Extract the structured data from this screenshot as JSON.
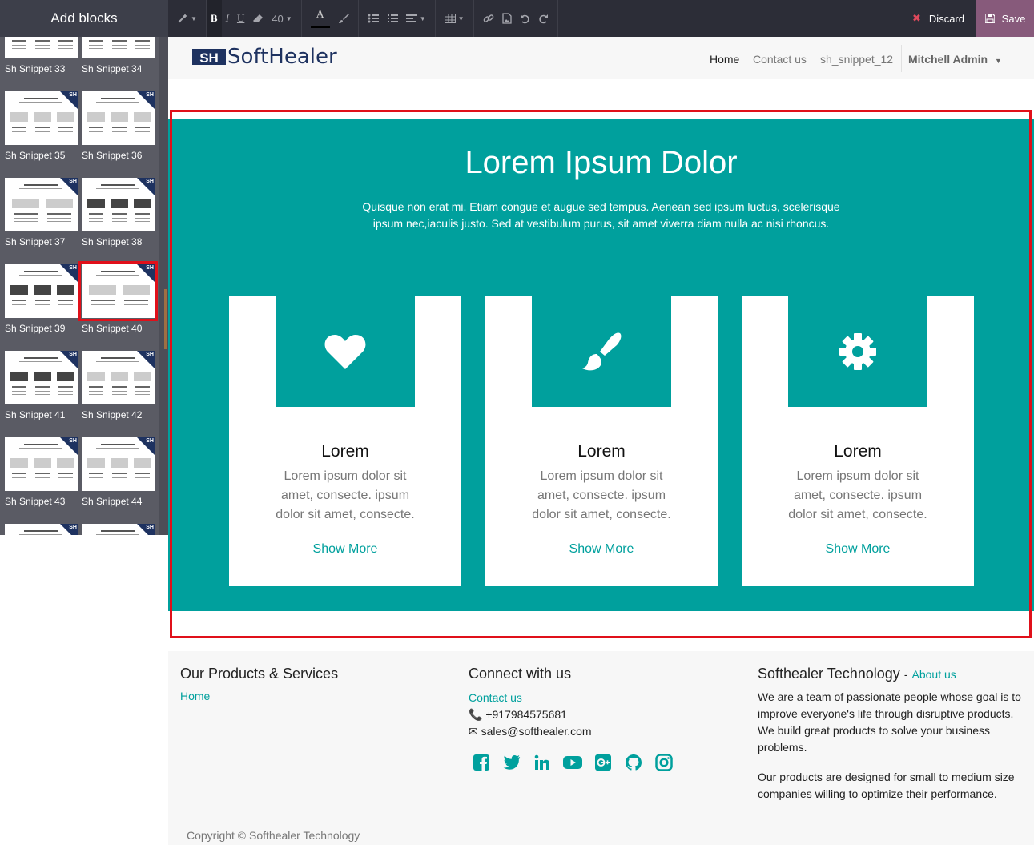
{
  "editor": {
    "sidebar_title": "Add blocks",
    "font_size": "40",
    "discard_label": "Discard",
    "save_label": "Save"
  },
  "snippets": [
    {
      "label": "Sh Snippet 33"
    },
    {
      "label": "Sh Snippet 34"
    },
    {
      "label": "Sh Snippet 35"
    },
    {
      "label": "Sh Snippet 36"
    },
    {
      "label": "Sh Snippet 37"
    },
    {
      "label": "Sh Snippet 38"
    },
    {
      "label": "Sh Snippet 39"
    },
    {
      "label": "Sh Snippet 40"
    },
    {
      "label": "Sh Snippet 41"
    },
    {
      "label": "Sh Snippet 42"
    },
    {
      "label": "Sh Snippet 43"
    },
    {
      "label": "Sh Snippet 44"
    },
    {
      "label": ""
    },
    {
      "label": ""
    }
  ],
  "snippet_badge": "SH",
  "nav": {
    "logo_text": "SoftHealer",
    "logo_mark": "SH",
    "home": "Home",
    "contact": "Contact us",
    "snippet": "sh_snippet_12",
    "user": "Mitchell Admin"
  },
  "hero": {
    "title": "Lorem Ipsum Dolor",
    "subtitle": "Quisque non erat mi. Etiam congue et augue sed tempus. Aenean sed ipsum luctus, scelerisque ipsum nec,iaculis justo. Sed at vestibulum purus, sit amet viverra diam nulla ac nisi rhoncus.",
    "cards": [
      {
        "icon": "heart-icon",
        "title": "Lorem",
        "text": "Lorem ipsum dolor sit amet, consecte. ipsum dolor sit amet, consecte.",
        "link": "Show More"
      },
      {
        "icon": "paint-brush-icon",
        "title": "Lorem",
        "text": "Lorem ipsum dolor sit amet, consecte. ipsum dolor sit amet, consecte.",
        "link": "Show More"
      },
      {
        "icon": "gear-icon",
        "title": "Lorem",
        "text": "Lorem ipsum dolor sit amet, consecte. ipsum dolor sit amet, consecte.",
        "link": "Show More"
      }
    ]
  },
  "footer": {
    "col1_title": "Our Products & Services",
    "col1_link": "Home",
    "col2_title": "Connect with us",
    "col2_contact": "Contact us",
    "phone": "+917984575681",
    "email": "sales@softhealer.com",
    "col3_title": "Softhealer Technology",
    "col3_sep": "-",
    "col3_link": "About us",
    "about_p1": "We are a team of passionate people whose goal is to improve everyone's life through disruptive products. We build great products to solve your business problems.",
    "about_p2": "Our products are designed for small to medium size companies willing to optimize their performance.",
    "copyright": "Copyright © Softhealer Technology",
    "social": [
      "facebook-icon",
      "twitter-icon",
      "linkedin-icon",
      "youtube-icon",
      "google-plus-icon",
      "github-icon",
      "instagram-icon"
    ]
  },
  "colors": {
    "accent": "#00a09d",
    "save": "#875a7b",
    "selection": "#e0101a",
    "brand": "#1e3260"
  }
}
